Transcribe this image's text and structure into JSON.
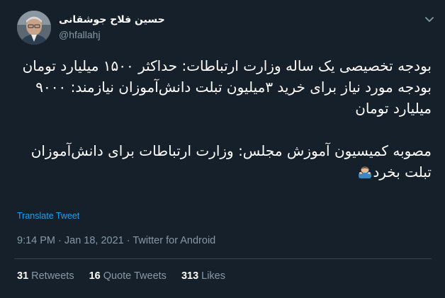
{
  "author": {
    "display_name": "حسین فلاح جوشقانی",
    "handle": "@hfallahj"
  },
  "tweet": {
    "line1": "بودجه تخصیصی یک ساله وزارت ارتباطات: حداکثر ۱۵۰۰ میلیارد تومان",
    "line2": "بودجه مورد نیاز برای خرید ۳میلیون تبلت دانش‌آموزان نیازمند: ۹۰۰۰ میلیارد تومان",
    "line3": "مصوبه کمیسیون آموزش مجلس: وزارت ارتباطات برای دانش‌آموزان تبلت بخرد"
  },
  "translate_label": "Translate Tweet",
  "meta": {
    "time": "9:14 PM",
    "separator": " · ",
    "date": "Jan 18, 2021",
    "source": "Twitter for Android"
  },
  "stats": {
    "retweets_count": "31",
    "retweets_label": "Retweets",
    "quotes_count": "16",
    "quotes_label": "Quote Tweets",
    "likes_count": "313",
    "likes_label": "Likes"
  },
  "icons": {
    "more": "more-options-icon",
    "emoji": "person-bowing-emoji"
  },
  "colors": {
    "background": "#15202b",
    "secondary_text": "#8899a6",
    "link": "#1da1f2",
    "divider": "#38444d"
  }
}
